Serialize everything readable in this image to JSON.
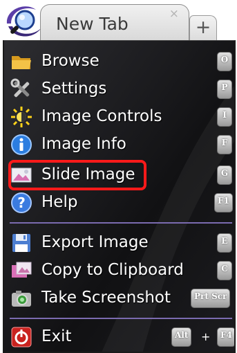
{
  "tab": {
    "title": "New Tab",
    "close_glyph": "×",
    "new_tab_glyph": "+"
  },
  "menu": {
    "items": [
      {
        "label": "Browse",
        "icon": "folder-icon",
        "shortcut": [
          "O"
        ]
      },
      {
        "label": "Settings",
        "icon": "tools-icon",
        "shortcut": [
          "P"
        ]
      },
      {
        "label": "Image Controls",
        "icon": "sun-icon",
        "shortcut": [
          "I"
        ]
      },
      {
        "label": "Image Info",
        "icon": "info-icon",
        "shortcut": [
          "F"
        ]
      },
      {
        "label": "Slide Image",
        "icon": "slide-image-icon",
        "shortcut": [
          "G"
        ]
      },
      {
        "label": "Help",
        "icon": "help-icon",
        "shortcut": [
          "F1"
        ]
      },
      {
        "label": "Export Image",
        "icon": "save-icon",
        "shortcut": [
          "E"
        ]
      },
      {
        "label": "Copy to Clipboard",
        "icon": "clipboard-icon",
        "shortcut": [
          "C"
        ]
      },
      {
        "label": "Take Screenshot",
        "icon": "camera-icon",
        "shortcut": [
          "Prt Scr"
        ]
      },
      {
        "label": "Exit",
        "icon": "power-icon",
        "shortcut": [
          "Alt",
          "F4"
        ],
        "shortcut_joiner": "+"
      }
    ]
  },
  "colors": {
    "highlight": "#ff1a1a",
    "menu_background": "#1b1b1e",
    "separator": "#7b6bb0"
  }
}
